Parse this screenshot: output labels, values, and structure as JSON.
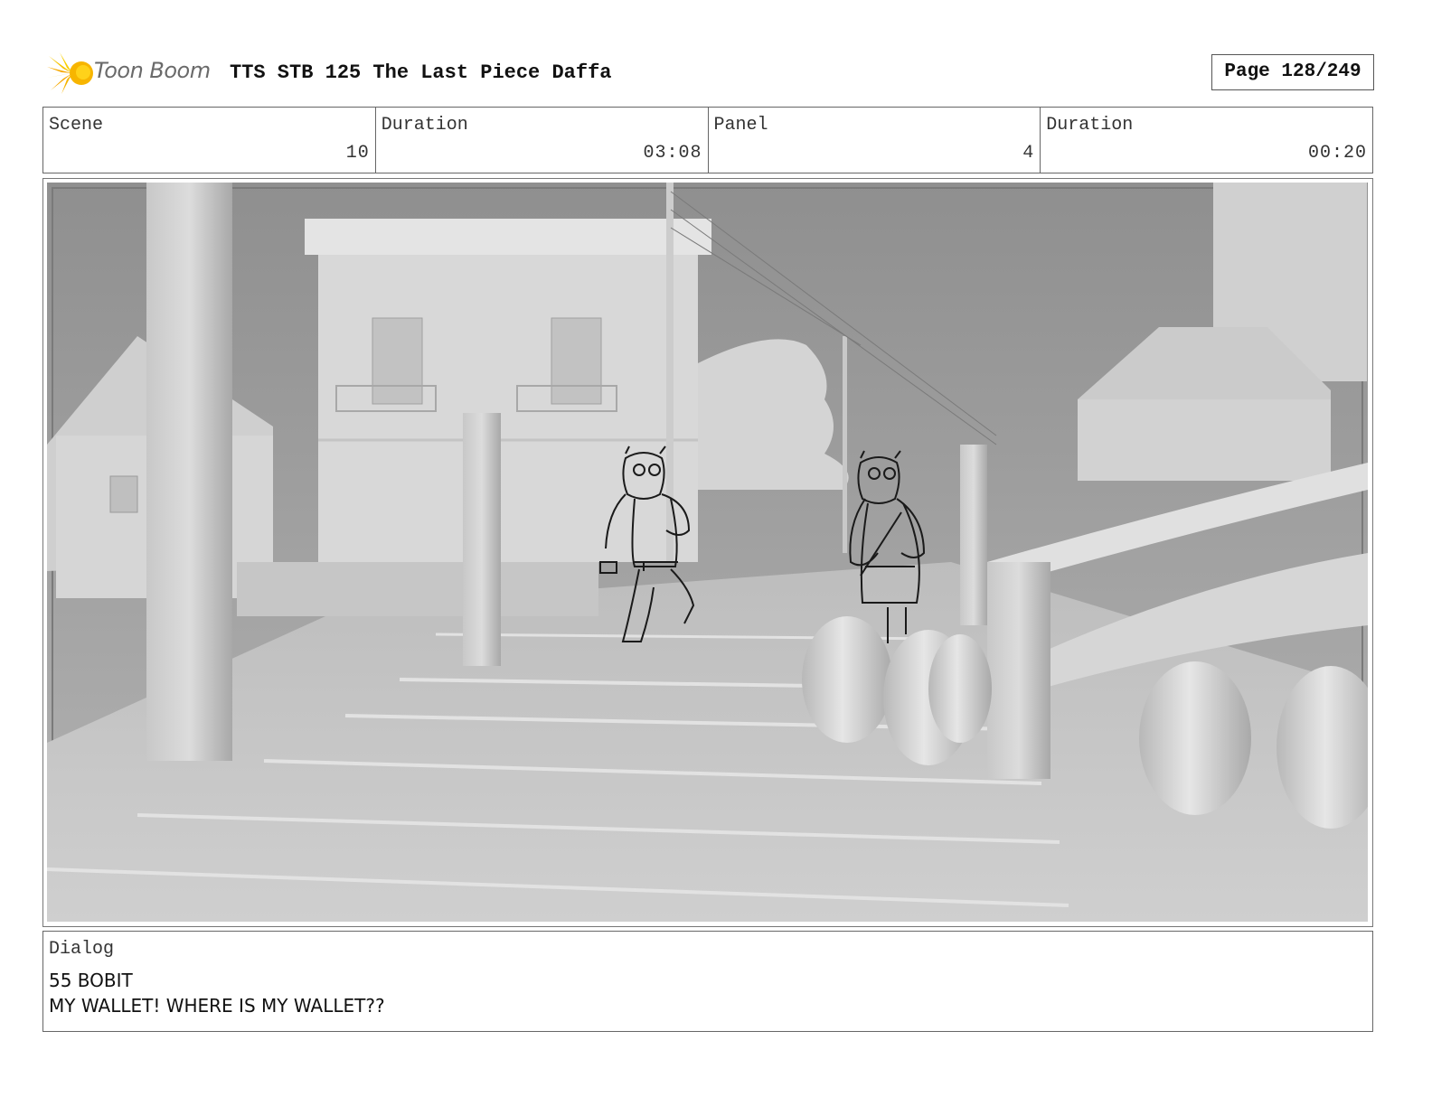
{
  "header": {
    "logo_text": "Toon Boom",
    "title": "TTS STB 125 The Last Piece Daffa",
    "page_label": "Page 128/249"
  },
  "info": {
    "scene_label": "Scene",
    "scene_value": "10",
    "scene_duration_label": "Duration",
    "scene_duration_value": "03:08",
    "panel_label": "Panel",
    "panel_value": "4",
    "panel_duration_label": "Duration",
    "panel_duration_value": "00:20"
  },
  "dialog": {
    "label": "Dialog",
    "line1": "55 BOBIT",
    "line2": "MY WALLET! WHERE IS MY WALLET??"
  },
  "colors": {
    "logo_yellow": "#f5b400",
    "logo_text": "#6a6a6a",
    "sky": "#9a9a9a",
    "scene_light": "#d9d9d9"
  }
}
